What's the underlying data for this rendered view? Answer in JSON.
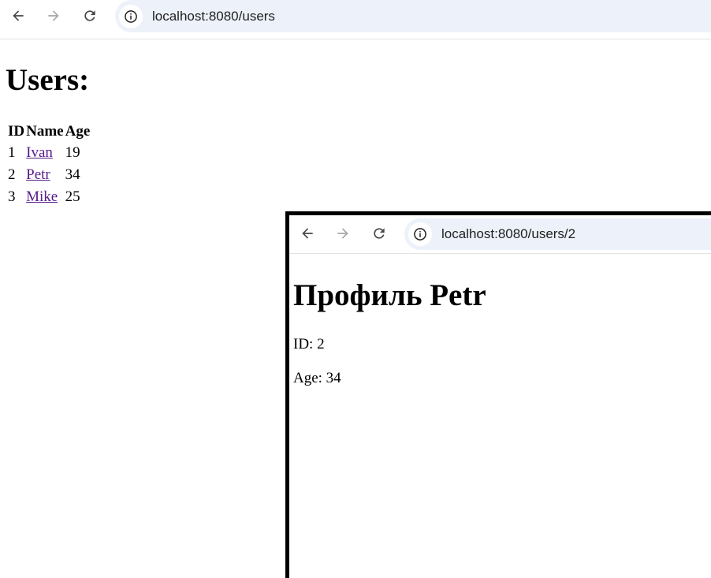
{
  "browser_main": {
    "url": "localhost:8080/users"
  },
  "page": {
    "title": "Users:",
    "table": {
      "headers": [
        "ID",
        "Name",
        "Age"
      ],
      "rows": [
        {
          "id": "1",
          "name": "Ivan",
          "age": "19"
        },
        {
          "id": "2",
          "name": "Petr",
          "age": "34"
        },
        {
          "id": "3",
          "name": "Mike",
          "age": "25"
        }
      ]
    }
  },
  "browser_profile": {
    "url": "localhost:8080/users/2"
  },
  "profile": {
    "title": "Профиль Petr",
    "id_line": "ID: 2",
    "age_line": "Age: 34"
  },
  "colors": {
    "link_visited": "#551a8b",
    "omnibox_bg": "#edf2fa",
    "window_border": "#000000"
  },
  "icons": [
    "back-arrow-icon",
    "forward-arrow-icon",
    "reload-icon",
    "site-info-icon"
  ]
}
